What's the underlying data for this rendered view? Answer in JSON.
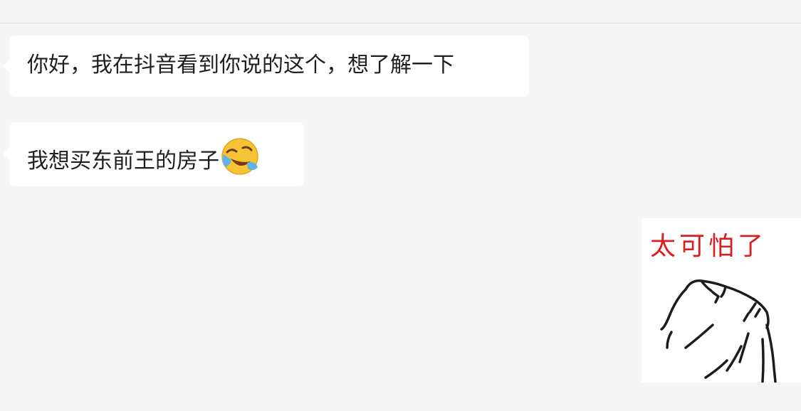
{
  "messages": [
    {
      "sender": "other",
      "text": "你好，我在抖音看到你说的这个，想了解一下"
    },
    {
      "sender": "other",
      "text": "我想买东前王的房子",
      "emoji": "laughing-crying-emoji"
    },
    {
      "sender": "self",
      "type": "sticker",
      "sticker_text": "太可怕了",
      "sticker_text_color": "#d81e1e",
      "sticker_image": "hand-covering-face-sketch"
    }
  ],
  "colors": {
    "background": "#f5f5f5",
    "bubble": "#ffffff",
    "text": "#1f1f1f"
  }
}
